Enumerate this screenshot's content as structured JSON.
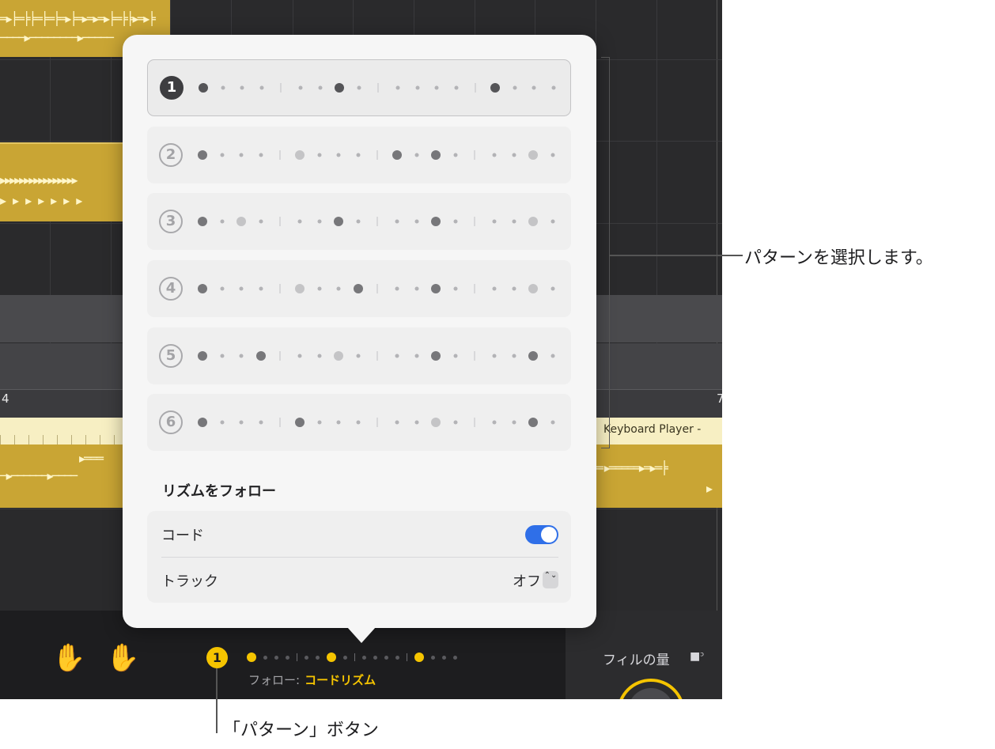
{
  "arrange": {
    "ruler_numbers": [
      "4",
      "7"
    ],
    "region_label": "Keyboard Player -"
  },
  "popover": {
    "patterns": [
      {
        "number": "1",
        "selected": true,
        "dots": [
          "big",
          "s",
          "s",
          "s",
          "|",
          "s",
          "s",
          "big",
          "s",
          "|",
          "s",
          "s",
          "s",
          "s",
          "|",
          "big",
          "s",
          "s",
          "s"
        ]
      },
      {
        "number": "2",
        "selected": false,
        "dots": [
          "big",
          "s",
          "s",
          "s",
          "|",
          "med",
          "s",
          "s",
          "s",
          "|",
          "big",
          "s",
          "big",
          "s",
          "|",
          "s",
          "s",
          "med",
          "s"
        ]
      },
      {
        "number": "3",
        "selected": false,
        "dots": [
          "big",
          "s",
          "med",
          "s",
          "|",
          "s",
          "s",
          "big",
          "s",
          "|",
          "s",
          "s",
          "big",
          "s",
          "|",
          "s",
          "s",
          "med",
          "s"
        ]
      },
      {
        "number": "4",
        "selected": false,
        "dots": [
          "big",
          "s",
          "s",
          "s",
          "|",
          "med",
          "s",
          "s",
          "big",
          "|",
          "s",
          "s",
          "big",
          "s",
          "|",
          "s",
          "s",
          "med",
          "s"
        ]
      },
      {
        "number": "5",
        "selected": false,
        "dots": [
          "big",
          "s",
          "s",
          "big",
          "|",
          "s",
          "s",
          "med",
          "s",
          "|",
          "s",
          "s",
          "big",
          "s",
          "|",
          "s",
          "s",
          "big",
          "s"
        ]
      },
      {
        "number": "6",
        "selected": false,
        "dots": [
          "big",
          "s",
          "s",
          "s",
          "|",
          "big",
          "s",
          "s",
          "s",
          "|",
          "s",
          "s",
          "med",
          "s",
          "|",
          "s",
          "s",
          "big",
          "s"
        ]
      }
    ],
    "section_title": "リズムをフォロー",
    "chord": {
      "label": "コード",
      "toggle_on": true
    },
    "track": {
      "label": "トラック",
      "value": "オフ",
      "stepper_glyph": "⌃⌄"
    }
  },
  "bottom_bar": {
    "pattern_button": "1",
    "follow_label": "フォロー:",
    "follow_value": "コードリズム",
    "fill_label": "フィルの量",
    "lock_icon": "lock-open-icon",
    "hand_icons": [
      "hand-icon",
      "hand-icon"
    ]
  },
  "callouts": {
    "select_pattern": "パターンを選択します。",
    "pattern_button": "「パターン」ボタン"
  },
  "colors": {
    "accent_yellow": "#f5c400",
    "toggle_blue": "#2f6fe8",
    "region_gold": "#c9a534"
  }
}
